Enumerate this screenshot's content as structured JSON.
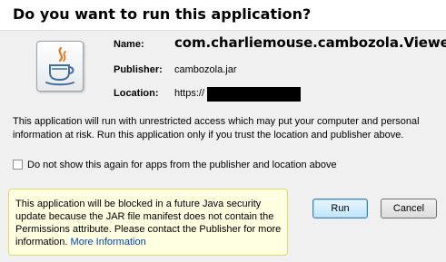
{
  "dialog": {
    "title": "Do you want to run this application?"
  },
  "app_info": {
    "icon": "java-icon",
    "name_label": "Name:",
    "name_value": "com.charliemouse.cambozola.Viewer",
    "publisher_label": "Publisher:",
    "publisher_value": "cambozola.jar",
    "location_label": "Location:",
    "location_value": "https://"
  },
  "warning": {
    "text": "This application will run with unrestricted access which may put your computer and personal information at risk. Run this application only if you trust the location and publisher above."
  },
  "checkbox": {
    "label": "Do not show this again for apps from the publisher and location above",
    "checked": false
  },
  "notice": {
    "text": "This application will be blocked in a future Java security update because the JAR file manifest does not contain the Permissions attribute. Please contact the Publisher for more information.",
    "link_label": "More Information"
  },
  "buttons": {
    "run_label": "Run",
    "cancel_label": "Cancel"
  }
}
